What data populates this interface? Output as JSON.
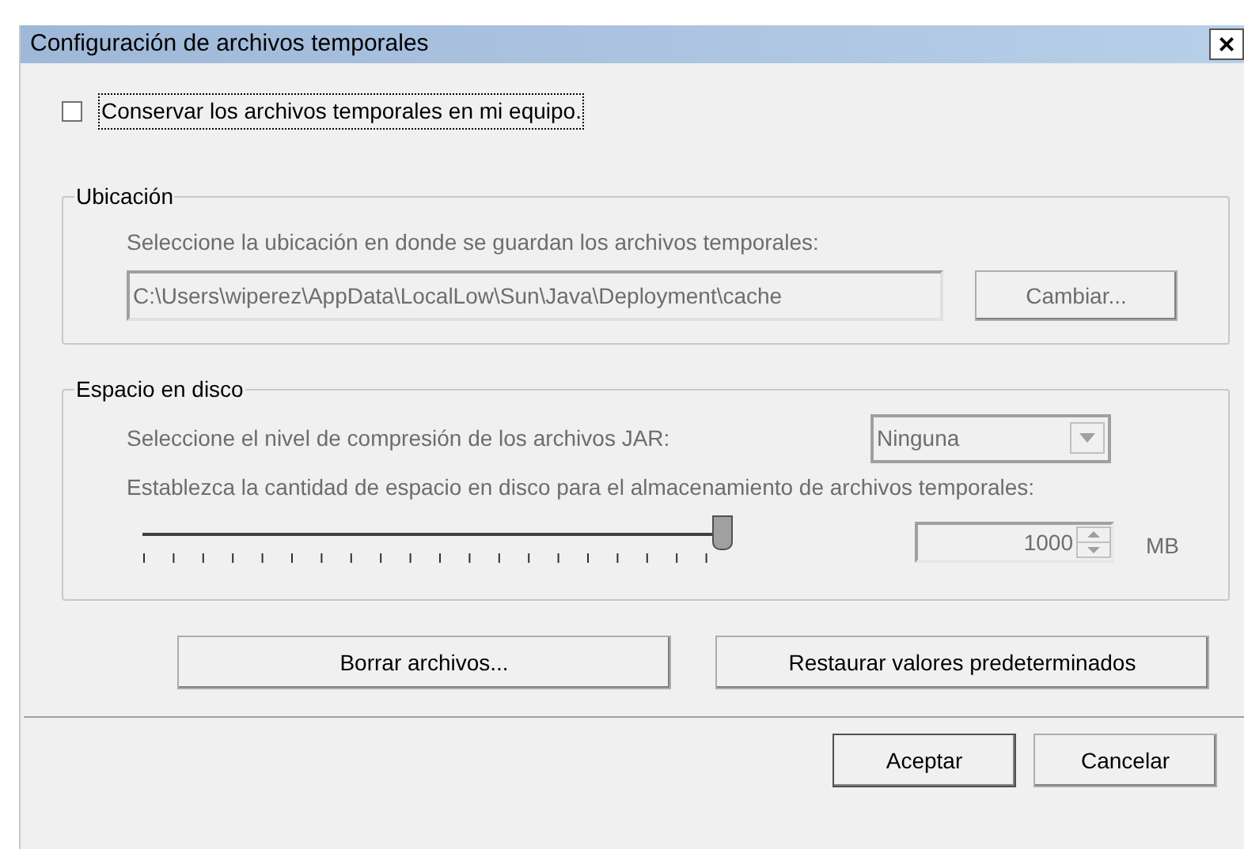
{
  "window": {
    "title": "Configuración de archivos temporales",
    "close": "×"
  },
  "keep_files": {
    "label": "Conservar los archivos temporales en mi equipo.",
    "checked": false
  },
  "location": {
    "title": "Ubicación",
    "prompt": "Seleccione la ubicación en donde se guardan los archivos temporales:",
    "path": "C:\\Users\\wiperez\\AppData\\LocalLow\\Sun\\Java\\Deployment\\cache",
    "change_button": "Cambiar...",
    "disabled": true
  },
  "disk": {
    "title": "Espacio en disco",
    "compression_prompt": "Seleccione el nivel de compresión de los archivos JAR:",
    "compression": "Ninguna",
    "space_prompt": "Establezca la cantidad de espacio en disco para el almacenamiento de archivos temporales:",
    "slider": {
      "level": 1
    },
    "size": "1000",
    "unit": "MB",
    "disabled": true
  },
  "actions": [
    "Borrar archivos...",
    "Restaurar valores predeterminados"
  ],
  "buttons": [
    "Aceptar",
    "Cancelar"
  ]
}
